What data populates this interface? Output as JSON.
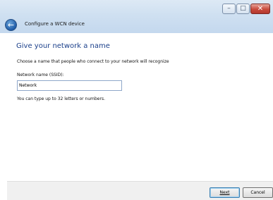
{
  "window": {
    "title": "Configure a WCN device",
    "controls": {
      "minimize": "–",
      "maximize": "□",
      "close": "✕"
    },
    "back_glyph": "←"
  },
  "page": {
    "heading": "Give your network a name",
    "description": "Choose a name that people who connect to your network will recognize",
    "ssid_label": "Network name (SSID):",
    "ssid_value": "Network",
    "hint": "You can type up to 32 letters or numbers."
  },
  "buttons": {
    "next": "Next",
    "cancel": "Cancel"
  },
  "colors": {
    "heading": "#1a3f8a",
    "titlebar": "#cfe0f1"
  }
}
